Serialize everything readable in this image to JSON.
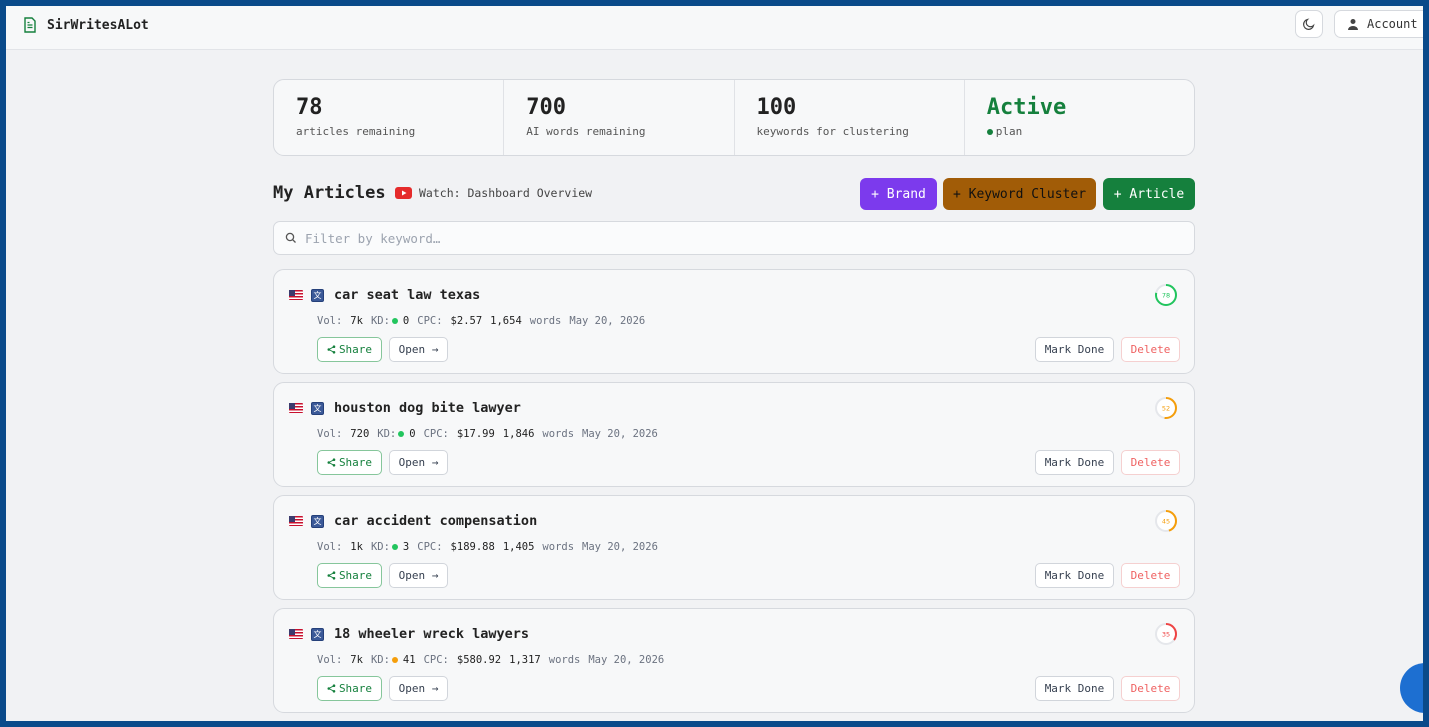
{
  "app": {
    "title": "SirWritesALot"
  },
  "header": {
    "account_label": "Account"
  },
  "stats": [
    {
      "value": "78",
      "label": "articles remaining"
    },
    {
      "value": "700",
      "label": "AI words remaining"
    },
    {
      "value": "100",
      "label": "keywords for clustering"
    },
    {
      "value": "Active",
      "label": "plan"
    }
  ],
  "section": {
    "title": "My Articles",
    "watch_label": "Watch: Dashboard Overview",
    "brand_button": "+ Brand",
    "cluster_button": "+ Keyword Cluster",
    "article_button": "+ Article"
  },
  "filter": {
    "placeholder": "Filter by keyword…"
  },
  "colors": {
    "brand": "#7c3aed",
    "cluster": "#a15c07",
    "article": "#15803d",
    "score_high": "#22c55e",
    "score_mid": "#f59e0b",
    "score_low": "#ef4444",
    "kd_easy": "#22c55e",
    "kd_mid": "#f59e0b"
  },
  "article_meta_labels": {
    "vol": "Vol:",
    "kd": "KD:",
    "cpc": "CPC:",
    "words": "words"
  },
  "article_actions": {
    "share": "Share",
    "open": "Open →",
    "mark_done": "Mark Done",
    "delete": "Delete"
  },
  "articles": [
    {
      "title": "car seat law texas",
      "score": 78,
      "vol": "7k",
      "kd": "0",
      "kd_color": "#22c55e",
      "cpc": "$2.57",
      "words": "1,654",
      "date": "May 20, 2026"
    },
    {
      "title": "houston dog bite lawyer",
      "score": 52,
      "vol": "720",
      "kd": "0",
      "kd_color": "#22c55e",
      "cpc": "$17.99",
      "words": "1,846",
      "date": "May 20, 2026"
    },
    {
      "title": "car accident compensation",
      "score": 45,
      "vol": "1k",
      "kd": "3",
      "kd_color": "#22c55e",
      "cpc": "$189.88",
      "words": "1,405",
      "date": "May 20, 2026"
    },
    {
      "title": "18 wheeler wreck lawyers",
      "score": 35,
      "vol": "7k",
      "kd": "41",
      "kd_color": "#f59e0b",
      "cpc": "$580.92",
      "words": "1,317",
      "date": "May 20, 2026"
    }
  ]
}
